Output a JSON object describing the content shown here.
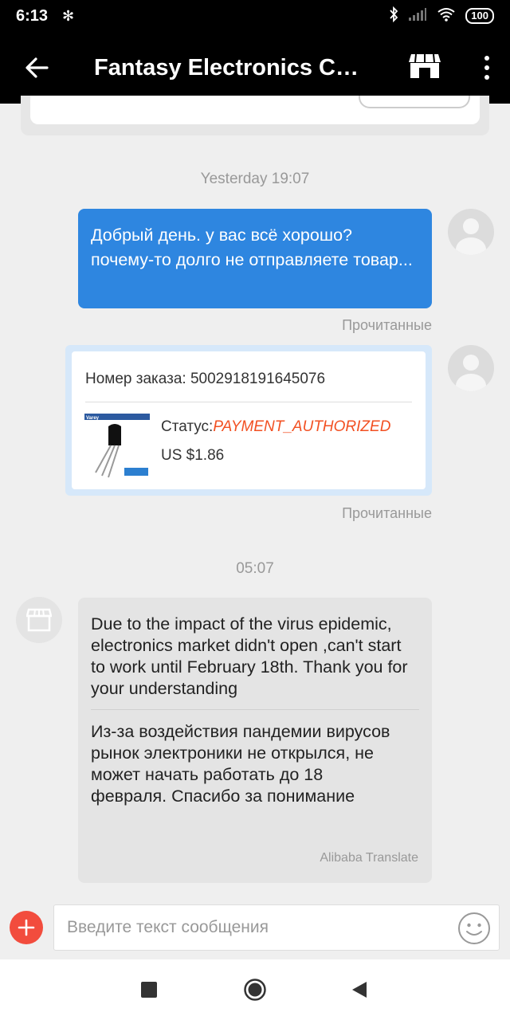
{
  "status_bar": {
    "time": "6:13",
    "battery": "100"
  },
  "app_bar": {
    "title": "Fantasy Electronics CO.,..."
  },
  "messages": {
    "ts1": "Yesterday 19:07",
    "outgoing_text": "Добрый день. у вас всё хорошо? почему-то долго не отправляете товар...",
    "read_label_1": "Прочитанные",
    "order": {
      "number_label": "Номер заказа: 5002918191645076",
      "status_label": "Статус:",
      "status_value": "PAYMENT_AUTHORIZED",
      "price": "US $1.86",
      "product_brand": "Varey"
    },
    "read_label_2": "Прочитанные",
    "ts2": "05:07",
    "incoming_original": "Due to the impact of the virus epidemic, electronics market didn't open ,can't start to work until February 18th. Thank you for your understanding",
    "incoming_translation": "Из-за воздействия пандемии вирусов рынок электроники не открылся, не может начать работать до 18 февраля. Спасибо за понимание",
    "translate_credit": "Alibaba Translate"
  },
  "composer": {
    "placeholder": "Введите текст сообщения"
  },
  "colors": {
    "accent_blue": "#2e86e0",
    "status_orange": "#f25022",
    "plus_red": "#f24c3d"
  }
}
